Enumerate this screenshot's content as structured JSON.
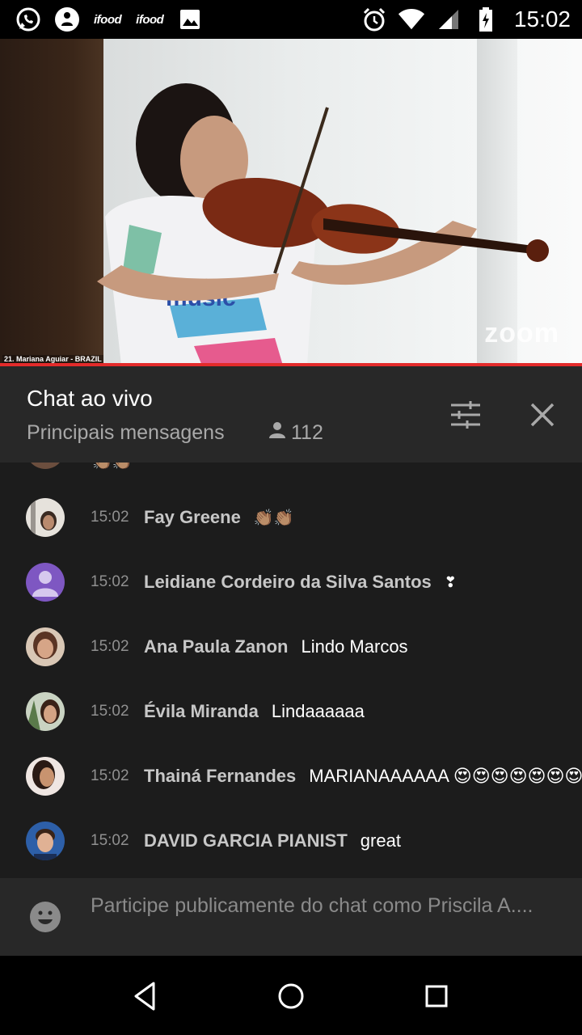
{
  "status_bar": {
    "time": "15:02",
    "left_icons": [
      "whatsapp-icon",
      "contact-icon",
      "ifood-icon",
      "ifood-icon",
      "gallery-icon"
    ],
    "ifood_label": "ifood",
    "right_icons": [
      "alarm-icon",
      "wifi-icon",
      "signal-icon",
      "battery-icon"
    ]
  },
  "video": {
    "caption": "21. Mariana Aguiar - BRAZIL",
    "watermark": "zoom",
    "progress_color": "#e32b2b"
  },
  "chat": {
    "title": "Chat ao vivo",
    "subtitle": "Principais mensagens",
    "viewer_count": "112",
    "messages": [
      {
        "time": "15:02",
        "author": "Fay Greene",
        "text": "",
        "emoji": "👏🏽👏🏽",
        "avatar_color": "#d8d0c8"
      },
      {
        "time": "15:02",
        "author": "Leidiane Cordeiro da Silva Santos",
        "text": "",
        "emoji": "❣",
        "avatar_color": "#7e57c2"
      },
      {
        "time": "15:02",
        "author": "Ana Paula Zanon",
        "text": "Lindo Marcos",
        "emoji": "",
        "avatar_color": "#b87a5a"
      },
      {
        "time": "15:02",
        "author": "Évila Miranda",
        "text": "Lindaaaaaa",
        "emoji": "",
        "avatar_color": "#8a9a7a"
      },
      {
        "time": "15:02",
        "author": "Thainá Fernandes",
        "text": "MARIANAAAAAA 😍😍😍😍😍😍😍😍",
        "emoji": "",
        "avatar_color": "#c9a48e"
      },
      {
        "time": "15:02",
        "author": "DAVID GARCIA PIANIST",
        "text": "great",
        "emoji": "",
        "avatar_color": "#2d5fa8"
      }
    ],
    "input_placeholder": "Participe publicamente do chat como Priscila A...."
  },
  "colors": {
    "header_bg": "#282828",
    "messages_bg": "#1c1c1c",
    "accent_red": "#e32b2b"
  }
}
